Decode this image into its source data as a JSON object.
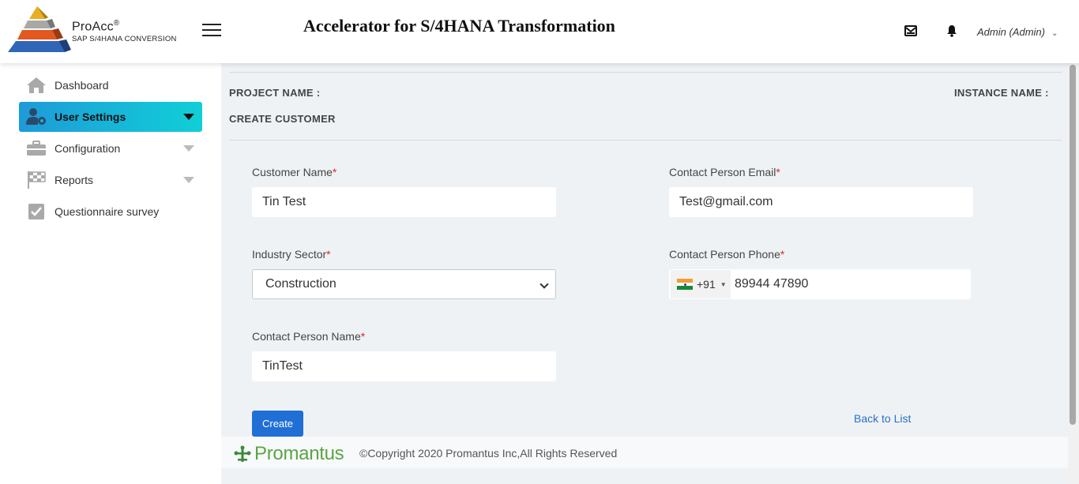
{
  "header": {
    "brand_name": "ProAcc",
    "brand_mark": "®",
    "brand_sub": "SAP S/4HANA CONVERSION",
    "title": "Accelerator for S/4HANA Transformation",
    "user_name": "Admin (Admin)",
    "icons": [
      "logo-pyramid-icon",
      "hamburger-menu-icon",
      "mail-icon",
      "bell-icon",
      "chevron-down-icon"
    ]
  },
  "sidebar": {
    "items": [
      {
        "label": "Dashboard",
        "icon": "home-icon",
        "active": false,
        "caret": false
      },
      {
        "label": "User Settings",
        "icon": "user-gear-icon",
        "active": true,
        "caret": true
      },
      {
        "label": "Configuration",
        "icon": "briefcase-icon",
        "active": false,
        "caret": true
      },
      {
        "label": "Reports",
        "icon": "checkered-flag-icon",
        "active": false,
        "caret": true
      },
      {
        "label": "Questionnaire survey",
        "icon": "checkbox-icon",
        "active": false,
        "caret": false
      }
    ]
  },
  "main": {
    "project_name_label": "PROJECT NAME :",
    "instance_name_label": "INSTANCE NAME :",
    "section_title": "CREATE CUSTOMER",
    "form": {
      "customer_name": {
        "label": "Customer Name",
        "required_mark": "*",
        "value": "Tin Test"
      },
      "contact_email": {
        "label": "Contact Person Email",
        "required_mark": "*",
        "value": "Test@gmail.com"
      },
      "industry_sector": {
        "label": "Industry Sector",
        "required_mark": "*",
        "value": "Construction"
      },
      "contact_phone": {
        "label": "Contact Person Phone",
        "required_mark": "*",
        "country_code": "+91",
        "country_flag": "india-flag-icon",
        "value": "89944 47890"
      },
      "contact_name": {
        "label": "Contact Person Name",
        "required_mark": "*",
        "value": "TinTest"
      }
    },
    "create_label": "Create",
    "back_label": "Back to List"
  },
  "footer": {
    "logo_text": "Promantus",
    "copyright": "©Copyright 2020 Promantus Inc,All Rights Reserved"
  },
  "colors": {
    "accent_gradient_start": "#1e9ad9",
    "accent_gradient_end": "#10cfd6",
    "primary_button": "#1f6fd6",
    "link": "#2a6fc9",
    "required": "#e0242c",
    "footer_logo": "#5aa545",
    "content_bg": "#eff2f5"
  }
}
